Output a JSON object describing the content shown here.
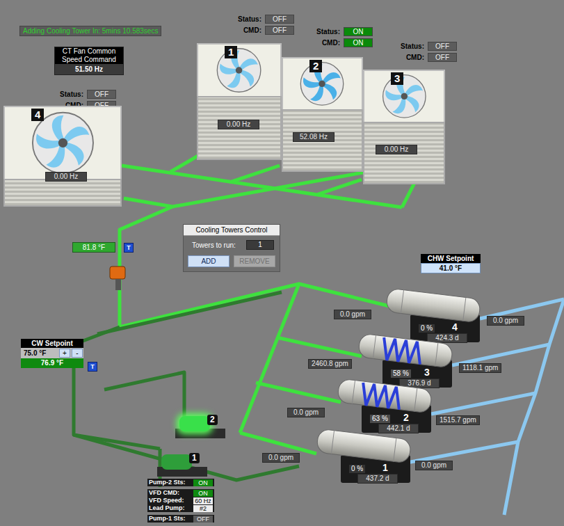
{
  "banner": "Adding Cooling Tower In: 5mins 10.583secs",
  "fanSpeed": {
    "title": [
      "CT Fan Common",
      "Speed Command"
    ],
    "value": "51.50 Hz"
  },
  "labels": {
    "status": "Status:",
    "cmd": "CMD:"
  },
  "towers": [
    {
      "number": "1",
      "status": "OFF",
      "cmd": "OFF",
      "speed": "0.00 Hz",
      "running": false
    },
    {
      "number": "2",
      "status": "ON",
      "cmd": "ON",
      "speed": "52.08 Hz",
      "running": true
    },
    {
      "number": "3",
      "status": "OFF",
      "cmd": "OFF",
      "speed": "0.00 Hz",
      "running": false
    },
    {
      "number": "4",
      "status": "OFF",
      "cmd": "OFF",
      "speed": "0.00 Hz",
      "running": false
    }
  ],
  "sensorIcon": "T",
  "cwReturnTemp": "81.8 °F",
  "towerControl": {
    "title": "Cooling Towers Control",
    "label": "Towers to run:",
    "value": "1",
    "buttons": [
      {
        "label": "ADD",
        "disabled": false
      },
      {
        "label": "REMOVE",
        "disabled": true
      }
    ]
  },
  "chwSetpoint": {
    "title": "CHW Setpoint",
    "value": "41.0 °F"
  },
  "cwSetpoint": {
    "title": "CW Setpoint",
    "value": "75.0 °F",
    "increment": "+",
    "decrement": "-",
    "reading": "76.9 °F"
  },
  "chillers": [
    {
      "number": "4",
      "load": "0 %",
      "runtime": "424.3 d",
      "cwFlow": "0.0 gpm",
      "chwFlow": "0.0 gpm",
      "running": false
    },
    {
      "number": "3",
      "load": "58 %",
      "runtime": "376.9 d",
      "cwFlow": "2460.8 gpm",
      "chwFlow": "1118.1 gpm",
      "running": true
    },
    {
      "number": "2",
      "load": "63 %",
      "runtime": "442.1 d",
      "cwFlow": "0.0 gpm",
      "chwFlow": "1515.7 gpm",
      "running": true
    },
    {
      "number": "1",
      "load": "0 %",
      "runtime": "437.2 d",
      "cwFlow": "0.0 gpm",
      "chwFlow": "0.0 gpm",
      "running": false
    }
  ],
  "pumps": [
    {
      "number": "2",
      "running": true
    },
    {
      "number": "1",
      "running": false
    }
  ],
  "pumpPanel": [
    {
      "label": "Pump-2 Sts:",
      "value": "ON",
      "kind": "status",
      "on": true
    },
    {
      "label": "VFD CMD:",
      "value": "ON",
      "kind": "status",
      "on": true
    },
    {
      "label": "VFD Speed:",
      "value": "60 Hz",
      "kind": "value",
      "on": false
    },
    {
      "label": "Lead Pump:",
      "value": "#2",
      "kind": "value",
      "on": false
    },
    {
      "label": "Pump-1 Sts:",
      "value": "OFF",
      "kind": "status",
      "on": false
    }
  ]
}
